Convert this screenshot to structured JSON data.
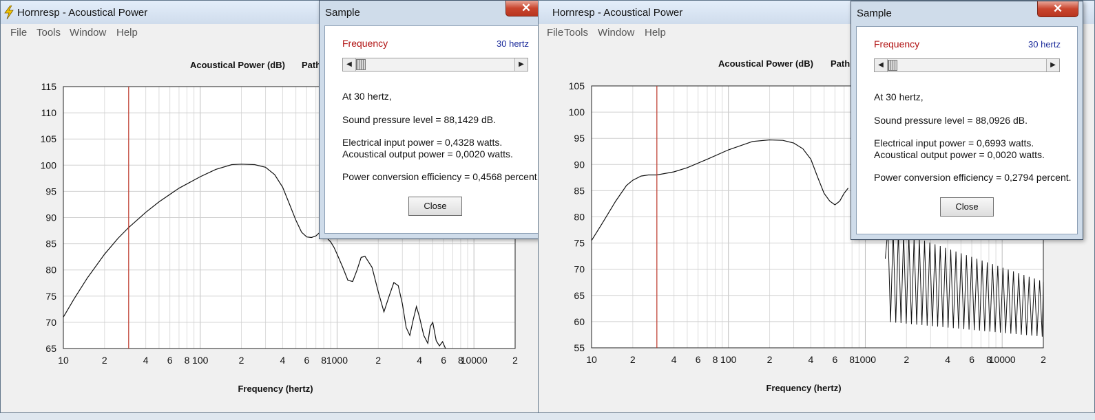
{
  "windows": [
    {
      "title": "Hornresp - Acoustical Power",
      "menu": [
        "File",
        "Tools",
        "Window",
        "Help"
      ],
      "chart_header": "Acoustical Power (dB)",
      "chart_header_extra": "Path",
      "dialog": {
        "title": "Sample",
        "close_glyph": "✕",
        "frequency_label": "Frequency",
        "frequency_value": "30 hertz",
        "line1": "At 30 hertz,",
        "line2": "Sound pressure level = 88,1429 dB.",
        "line3": "Electrical input power = 0,4328 watts.",
        "line4": "Acoustical output power = 0,0020 watts.",
        "line5": "Power conversion efficiency = 0,4568 percent.",
        "close_label": "Close"
      }
    },
    {
      "title": "Hornresp - Acoustical Power",
      "menu": [
        "File",
        "Tools",
        "Window",
        "Help"
      ],
      "chart_header": "Acoustical Power (dB)",
      "chart_header_extra": "Path",
      "dialog": {
        "title": "Sample",
        "close_glyph": "✕",
        "frequency_label": "Frequency",
        "frequency_value": "30 hertz",
        "line1": "At 30 hertz,",
        "line2": "Sound pressure level = 88,0926 dB.",
        "line3": "Electrical input power = 0,6993 watts.",
        "line4": "Acoustical output power = 0,0020 watts.",
        "line5": "Power conversion efficiency = 0,2794 percent.",
        "close_label": "Close"
      }
    }
  ],
  "chart_data": [
    {
      "type": "line",
      "title": "Acoustical Power (dB)",
      "xlabel": "Frequency (hertz)",
      "ylabel": "",
      "xscale": "log",
      "xlim": [
        10,
        20000
      ],
      "ylim": [
        65,
        115
      ],
      "yticks": [
        65,
        70,
        75,
        80,
        85,
        90,
        95,
        100,
        105,
        110,
        115
      ],
      "xtick_labels": [
        {
          "f": 10,
          "label": "10"
        },
        {
          "f": 20,
          "label": "2"
        },
        {
          "f": 40,
          "label": "4"
        },
        {
          "f": 60,
          "label": "6"
        },
        {
          "f": 80,
          "label": "8"
        },
        {
          "f": 100,
          "label": "100"
        },
        {
          "f": 200,
          "label": "2"
        },
        {
          "f": 400,
          "label": "4"
        },
        {
          "f": 600,
          "label": "6"
        },
        {
          "f": 800,
          "label": "8"
        },
        {
          "f": 1000,
          "label": "1000"
        },
        {
          "f": 2000,
          "label": "2"
        },
        {
          "f": 4000,
          "label": "4"
        },
        {
          "f": 6000,
          "label": "6"
        },
        {
          "f": 8000,
          "label": "8"
        },
        {
          "f": 10000,
          "label": "10000"
        },
        {
          "f": 20000,
          "label": "2"
        }
      ],
      "marker_frequency": 30,
      "grid": true,
      "series": [
        {
          "x": [
            10,
            12,
            15,
            20,
            25,
            30,
            40,
            50,
            70,
            100,
            130,
            170,
            200,
            250,
            300,
            350,
            400,
            450,
            500,
            550,
            600,
            650,
            700,
            750,
            800,
            850,
            900,
            950,
            1000,
            1100,
            1200,
            1300,
            1400,
            1500,
            1600,
            1800,
            2000,
            2200,
            2400,
            2600,
            2800,
            3000,
            3200,
            3400,
            3600,
            3800,
            4000,
            4300,
            4600,
            4800,
            5000,
            5300,
            5600,
            5900,
            6200
          ],
          "y": [
            71,
            74.5,
            78.5,
            83,
            86,
            88.1,
            91,
            93,
            95.6,
            97.8,
            99.2,
            100.1,
            100.2,
            100.1,
            99.6,
            98.2,
            95.8,
            92.5,
            89.5,
            87.2,
            86.3,
            86.2,
            86.5,
            87.2,
            86.8,
            86,
            85.3,
            84.3,
            83,
            80.5,
            78,
            77.8,
            80,
            82.4,
            82.6,
            80.5,
            75.8,
            72,
            75,
            77.6,
            77,
            73.5,
            69,
            67.5,
            70.5,
            73,
            71,
            67.5,
            66,
            69.2,
            70,
            66.5,
            65.5,
            66.3,
            65
          ]
        }
      ]
    },
    {
      "type": "line",
      "title": "Acoustical Power (dB)",
      "xlabel": "Frequency (hertz)",
      "ylabel": "",
      "xscale": "log",
      "xlim": [
        10,
        20000
      ],
      "ylim": [
        55,
        105
      ],
      "yticks": [
        55,
        60,
        65,
        70,
        75,
        80,
        85,
        90,
        95,
        100,
        105
      ],
      "xtick_labels": [
        {
          "f": 10,
          "label": "10"
        },
        {
          "f": 20,
          "label": "2"
        },
        {
          "f": 40,
          "label": "4"
        },
        {
          "f": 60,
          "label": "6"
        },
        {
          "f": 80,
          "label": "8"
        },
        {
          "f": 100,
          "label": "100"
        },
        {
          "f": 200,
          "label": "2"
        },
        {
          "f": 400,
          "label": "4"
        },
        {
          "f": 600,
          "label": "6"
        },
        {
          "f": 800,
          "label": "8"
        },
        {
          "f": 1000,
          "label": "1000"
        },
        {
          "f": 2000,
          "label": "2"
        },
        {
          "f": 4000,
          "label": "4"
        },
        {
          "f": 6000,
          "label": "6"
        },
        {
          "f": 8000,
          "label": "8"
        },
        {
          "f": 10000,
          "label": "10000"
        },
        {
          "f": 20000,
          "label": "2"
        }
      ],
      "marker_frequency": 30,
      "grid": true,
      "series": [
        {
          "x": [
            10,
            12,
            15,
            18,
            20,
            23,
            26,
            30,
            40,
            50,
            70,
            100,
            150,
            200,
            250,
            300,
            350,
            400,
            450,
            500,
            550,
            600,
            650,
            700,
            750
          ],
          "y": [
            75.5,
            78.8,
            83,
            86,
            87,
            87.8,
            88,
            88,
            88.6,
            89.4,
            91,
            92.8,
            94.4,
            94.7,
            94.6,
            94.1,
            93,
            91,
            87.5,
            84.5,
            83,
            82.3,
            83,
            84.5,
            85.5
          ]
        }
      ],
      "annotations": "dense comb-filter ripple between about 2000 and 20000 hertz, oscillating roughly between 57 and 78 dB with decreasing upper envelope"
    }
  ]
}
